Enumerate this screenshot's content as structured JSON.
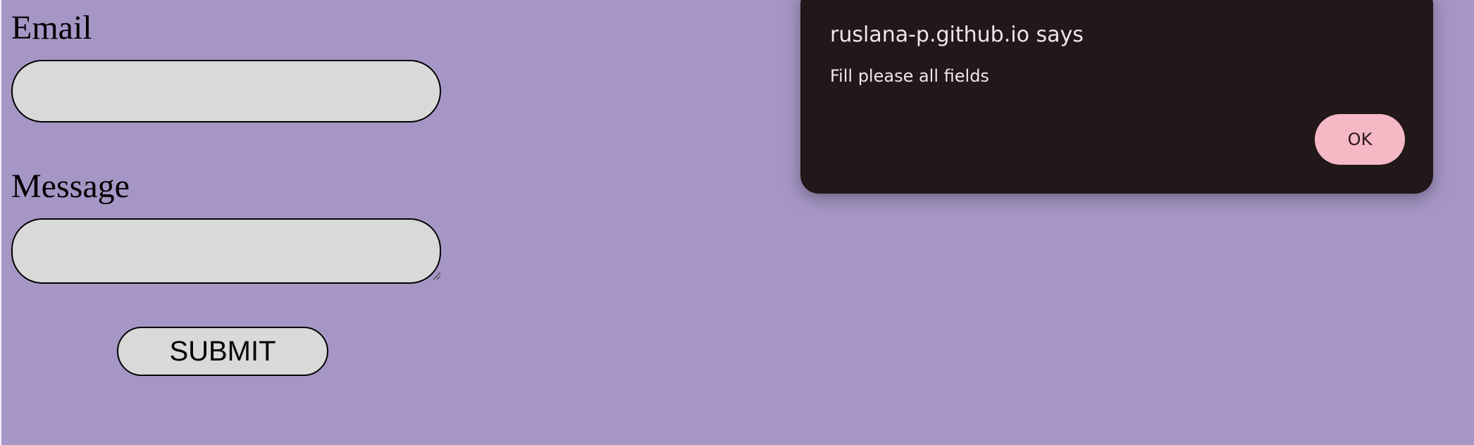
{
  "form": {
    "email_label": "Email",
    "email_value": "",
    "message_label": "Message",
    "message_value": "",
    "submit_label": "SUBMIT"
  },
  "alert": {
    "title": "ruslana-p.github.io says",
    "message": "Fill please all fields",
    "ok_label": "OK"
  },
  "colors": {
    "page_background": "#a696c6",
    "field_background": "#d9d9d9",
    "dialog_background": "#221719",
    "ok_button": "#f5b8c5"
  },
  "icons": {
    "resize_grip": "resize-grip-icon"
  }
}
